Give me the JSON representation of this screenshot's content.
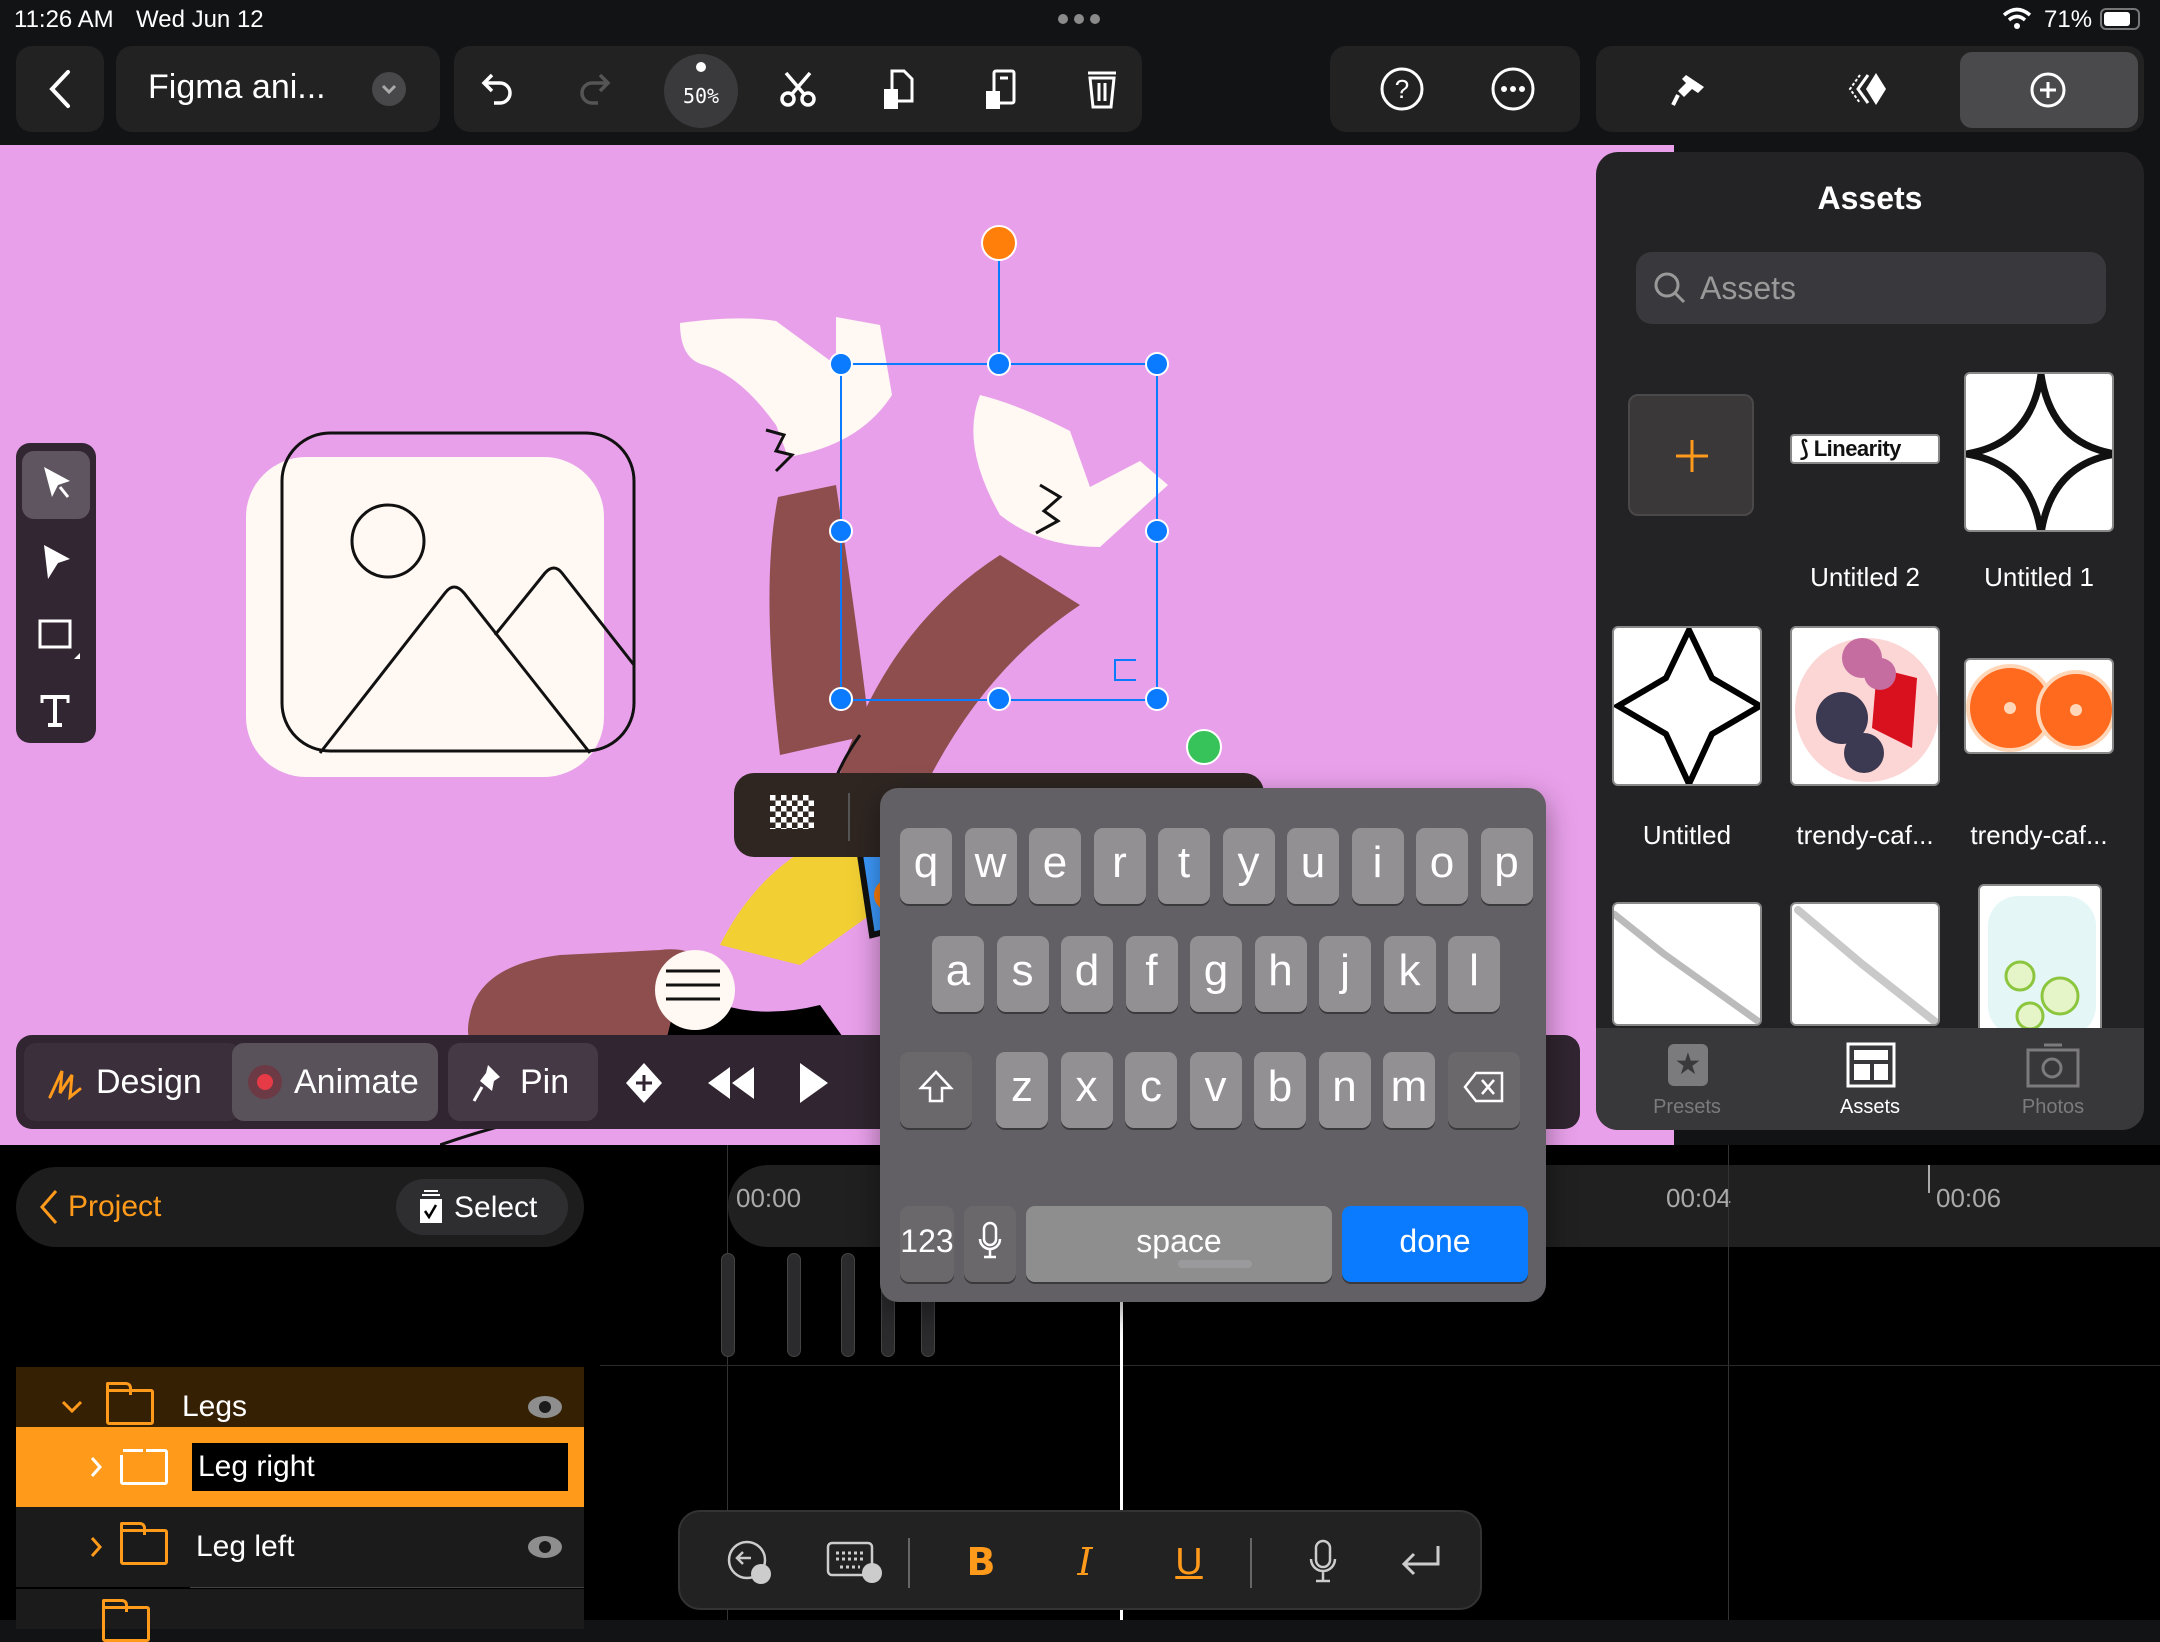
{
  "status_bar": {
    "time": "11:26 AM",
    "date": "Wed Jun 12",
    "battery": "71%"
  },
  "toolbar": {
    "back_icon": "chevron-left-icon",
    "document_title": "Figma ani...",
    "zoom_level": "50%",
    "undo_icon": "undo-icon",
    "redo_icon": "redo-icon",
    "cut_icon": "scissors-icon",
    "copy_icon": "copy-icon",
    "paste_icon": "paste-icon",
    "delete_icon": "trash-icon",
    "help_icon": "question-icon",
    "more_icon": "ellipsis-icon",
    "style_icon": "paintbrush-icon",
    "animate_icon": "keyframe-icon",
    "add_icon": "plus-circle-icon"
  },
  "tools": [
    "select-tool",
    "direct-select-tool",
    "rectangle-tool",
    "text-tool"
  ],
  "assets_panel": {
    "title": "Assets",
    "search_placeholder": "Assets",
    "items": [
      {
        "label": "",
        "kind": "add"
      },
      {
        "label": "Untitled 2",
        "kind": "linearity-logo",
        "logo_text": "Linearity"
      },
      {
        "label": "Untitled 1",
        "kind": "curved-star"
      },
      {
        "label": "Untitled",
        "kind": "star"
      },
      {
        "label": "trendy-caf...",
        "kind": "berries"
      },
      {
        "label": "trendy-caf...",
        "kind": "oranges"
      },
      {
        "label": "",
        "kind": "fork"
      },
      {
        "label": "",
        "kind": "knife"
      },
      {
        "label": "",
        "kind": "cucumber-water"
      }
    ],
    "tabs": [
      {
        "label": "Presets",
        "active": false
      },
      {
        "label": "Assets",
        "active": true
      },
      {
        "label": "Photos",
        "active": false
      }
    ]
  },
  "mode_bar": {
    "design": "Design",
    "animate": "Animate",
    "pin": "Pin"
  },
  "keyboard": {
    "row1": [
      "q",
      "w",
      "e",
      "r",
      "t",
      "y",
      "u",
      "i",
      "o",
      "p"
    ],
    "row2": [
      "a",
      "s",
      "d",
      "f",
      "g",
      "h",
      "j",
      "k",
      "l"
    ],
    "row3": [
      "z",
      "x",
      "c",
      "v",
      "b",
      "n",
      "m"
    ],
    "numbers": "123",
    "space": "space",
    "done": "done"
  },
  "layers": {
    "back_label": "Project",
    "select_label": "Select",
    "rows": [
      {
        "name": "Legs",
        "expanded": true,
        "visible": true
      },
      {
        "name": "Leg right",
        "editing": true
      },
      {
        "name": "Leg left",
        "expanded": false,
        "visible": true
      }
    ]
  },
  "timeline": {
    "ticks": [
      "00:00",
      "00:04",
      "00:06"
    ]
  },
  "format_bar": {
    "bold": "B",
    "italic": "I",
    "underline": "U"
  },
  "colors": {
    "accent": "#ff9a1a",
    "canvas": "#e9a0ea",
    "selection": "#0a7aff",
    "keyboard_done": "#0a7aff"
  }
}
